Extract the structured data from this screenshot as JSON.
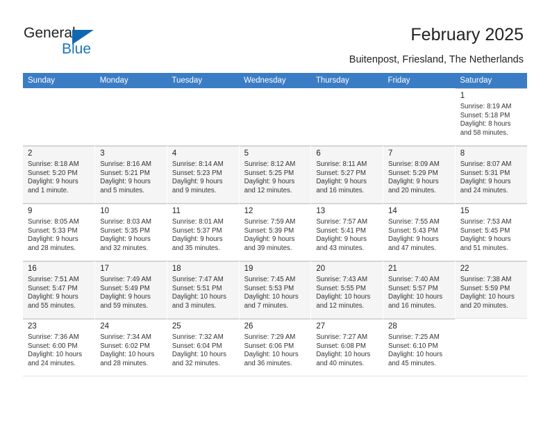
{
  "brand": {
    "name_dark": "General",
    "name_blue": "Blue",
    "accent_color": "#1b75bb",
    "header_color": "#3b7dc4"
  },
  "header": {
    "title": "February 2025",
    "subtitle": "Buitenpost, Friesland, The Netherlands"
  },
  "weekdays": [
    "Sunday",
    "Monday",
    "Tuesday",
    "Wednesday",
    "Thursday",
    "Friday",
    "Saturday"
  ],
  "weeks": [
    [
      {
        "day": "",
        "info": ""
      },
      {
        "day": "",
        "info": ""
      },
      {
        "day": "",
        "info": ""
      },
      {
        "day": "",
        "info": ""
      },
      {
        "day": "",
        "info": ""
      },
      {
        "day": "",
        "info": ""
      },
      {
        "day": "1",
        "info": "Sunrise: 8:19 AM\nSunset: 5:18 PM\nDaylight: 8 hours\nand 58 minutes."
      }
    ],
    [
      {
        "day": "2",
        "info": "Sunrise: 8:18 AM\nSunset: 5:20 PM\nDaylight: 9 hours\nand 1 minute."
      },
      {
        "day": "3",
        "info": "Sunrise: 8:16 AM\nSunset: 5:21 PM\nDaylight: 9 hours\nand 5 minutes."
      },
      {
        "day": "4",
        "info": "Sunrise: 8:14 AM\nSunset: 5:23 PM\nDaylight: 9 hours\nand 9 minutes."
      },
      {
        "day": "5",
        "info": "Sunrise: 8:12 AM\nSunset: 5:25 PM\nDaylight: 9 hours\nand 12 minutes."
      },
      {
        "day": "6",
        "info": "Sunrise: 8:11 AM\nSunset: 5:27 PM\nDaylight: 9 hours\nand 16 minutes."
      },
      {
        "day": "7",
        "info": "Sunrise: 8:09 AM\nSunset: 5:29 PM\nDaylight: 9 hours\nand 20 minutes."
      },
      {
        "day": "8",
        "info": "Sunrise: 8:07 AM\nSunset: 5:31 PM\nDaylight: 9 hours\nand 24 minutes."
      }
    ],
    [
      {
        "day": "9",
        "info": "Sunrise: 8:05 AM\nSunset: 5:33 PM\nDaylight: 9 hours\nand 28 minutes."
      },
      {
        "day": "10",
        "info": "Sunrise: 8:03 AM\nSunset: 5:35 PM\nDaylight: 9 hours\nand 32 minutes."
      },
      {
        "day": "11",
        "info": "Sunrise: 8:01 AM\nSunset: 5:37 PM\nDaylight: 9 hours\nand 35 minutes."
      },
      {
        "day": "12",
        "info": "Sunrise: 7:59 AM\nSunset: 5:39 PM\nDaylight: 9 hours\nand 39 minutes."
      },
      {
        "day": "13",
        "info": "Sunrise: 7:57 AM\nSunset: 5:41 PM\nDaylight: 9 hours\nand 43 minutes."
      },
      {
        "day": "14",
        "info": "Sunrise: 7:55 AM\nSunset: 5:43 PM\nDaylight: 9 hours\nand 47 minutes."
      },
      {
        "day": "15",
        "info": "Sunrise: 7:53 AM\nSunset: 5:45 PM\nDaylight: 9 hours\nand 51 minutes."
      }
    ],
    [
      {
        "day": "16",
        "info": "Sunrise: 7:51 AM\nSunset: 5:47 PM\nDaylight: 9 hours\nand 55 minutes."
      },
      {
        "day": "17",
        "info": "Sunrise: 7:49 AM\nSunset: 5:49 PM\nDaylight: 9 hours\nand 59 minutes."
      },
      {
        "day": "18",
        "info": "Sunrise: 7:47 AM\nSunset: 5:51 PM\nDaylight: 10 hours\nand 3 minutes."
      },
      {
        "day": "19",
        "info": "Sunrise: 7:45 AM\nSunset: 5:53 PM\nDaylight: 10 hours\nand 7 minutes."
      },
      {
        "day": "20",
        "info": "Sunrise: 7:43 AM\nSunset: 5:55 PM\nDaylight: 10 hours\nand 12 minutes."
      },
      {
        "day": "21",
        "info": "Sunrise: 7:40 AM\nSunset: 5:57 PM\nDaylight: 10 hours\nand 16 minutes."
      },
      {
        "day": "22",
        "info": "Sunrise: 7:38 AM\nSunset: 5:59 PM\nDaylight: 10 hours\nand 20 minutes."
      }
    ],
    [
      {
        "day": "23",
        "info": "Sunrise: 7:36 AM\nSunset: 6:00 PM\nDaylight: 10 hours\nand 24 minutes."
      },
      {
        "day": "24",
        "info": "Sunrise: 7:34 AM\nSunset: 6:02 PM\nDaylight: 10 hours\nand 28 minutes."
      },
      {
        "day": "25",
        "info": "Sunrise: 7:32 AM\nSunset: 6:04 PM\nDaylight: 10 hours\nand 32 minutes."
      },
      {
        "day": "26",
        "info": "Sunrise: 7:29 AM\nSunset: 6:06 PM\nDaylight: 10 hours\nand 36 minutes."
      },
      {
        "day": "27",
        "info": "Sunrise: 7:27 AM\nSunset: 6:08 PM\nDaylight: 10 hours\nand 40 minutes."
      },
      {
        "day": "28",
        "info": "Sunrise: 7:25 AM\nSunset: 6:10 PM\nDaylight: 10 hours\nand 45 minutes."
      },
      {
        "day": "",
        "info": ""
      }
    ]
  ]
}
